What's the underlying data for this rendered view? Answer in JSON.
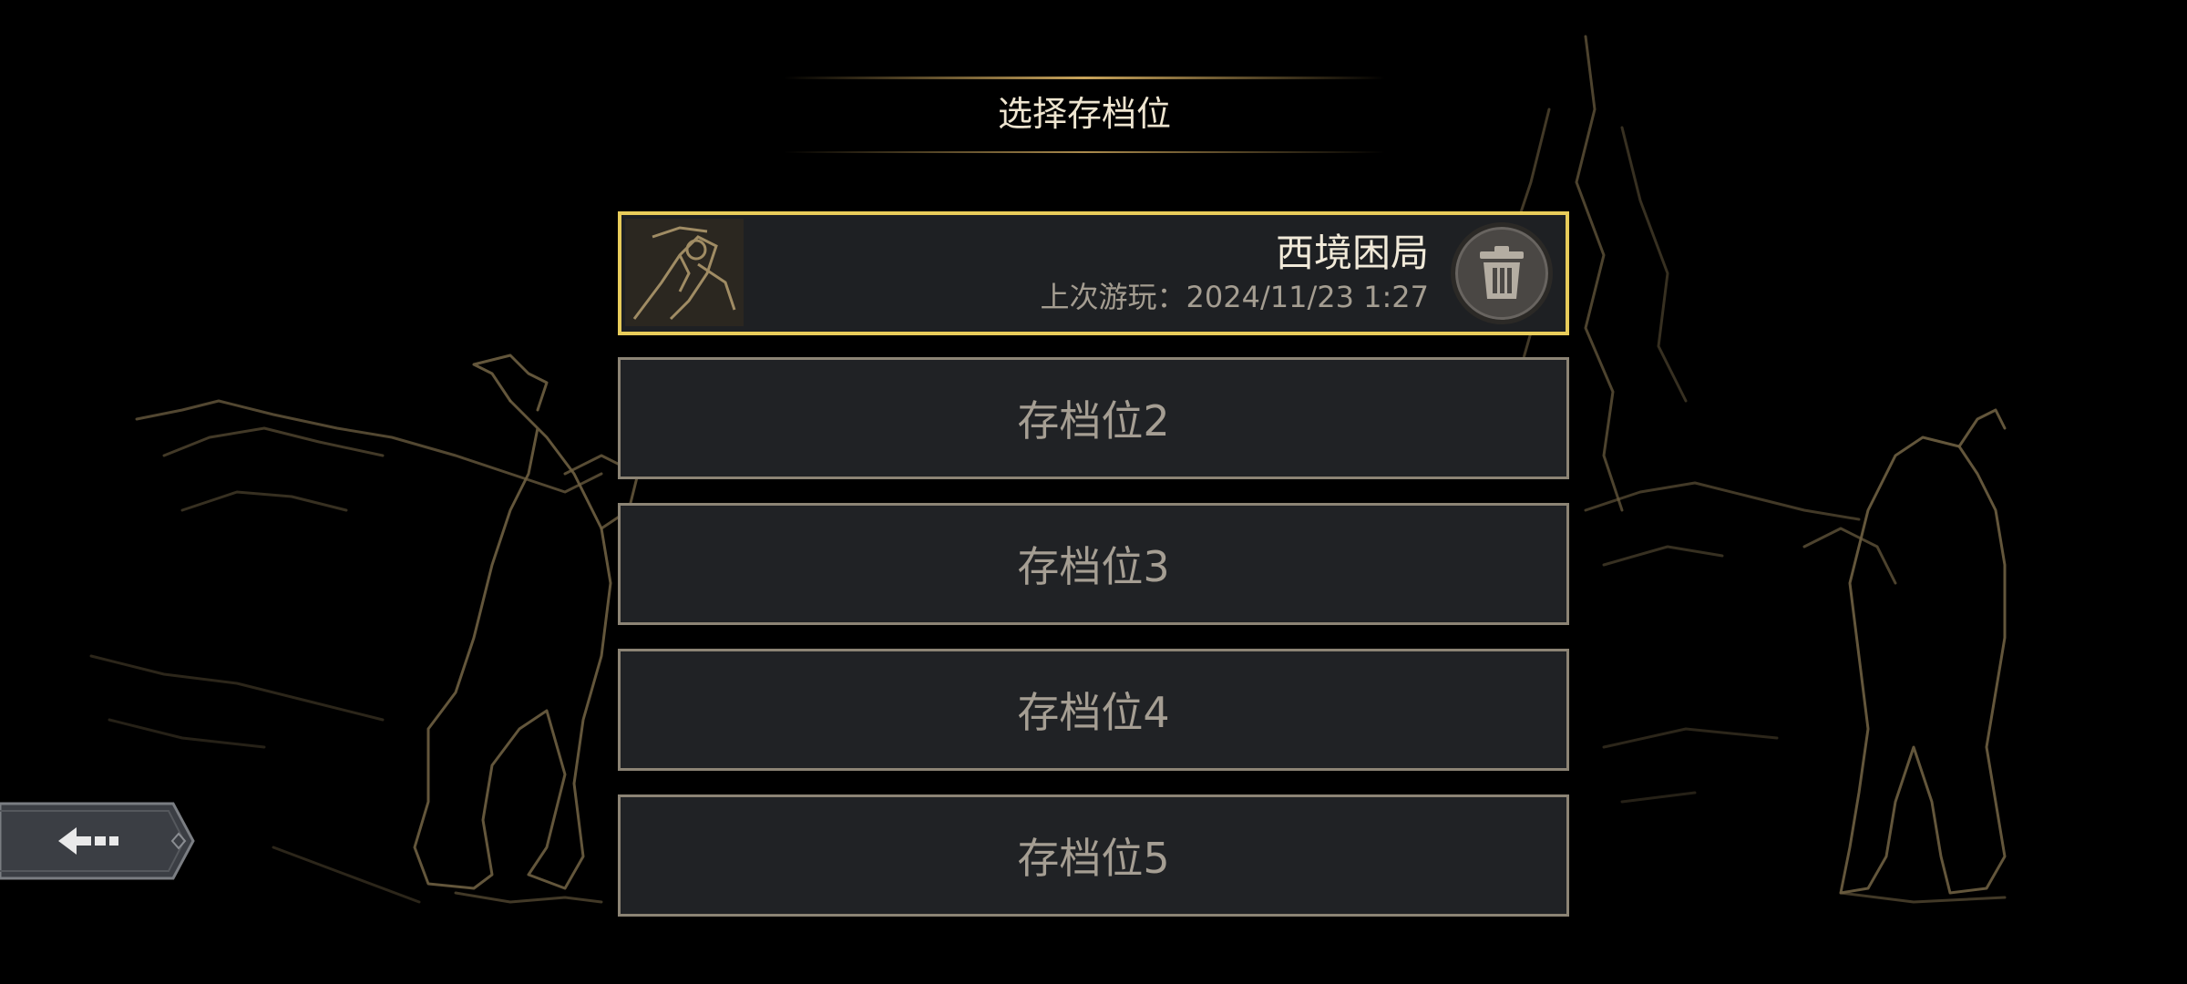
{
  "title": "选择存档位",
  "slots": [
    {
      "name": "西境困局",
      "last_played_label": "上次游玩：",
      "last_played": "2024/11/23 1:27"
    },
    {
      "label": "存档位2"
    },
    {
      "label": "存档位3"
    },
    {
      "label": "存档位4"
    },
    {
      "label": "存档位5"
    }
  ],
  "icons": {
    "delete": "trash-icon",
    "back": "back-arrow-icon"
  },
  "colors": {
    "background": "#000000",
    "line_art": "#7a6a48",
    "gold_accent": "#e8cc5a",
    "slot_bg": "#202225",
    "slot_border": "#8c8475",
    "slot_text": "#a59e93"
  }
}
